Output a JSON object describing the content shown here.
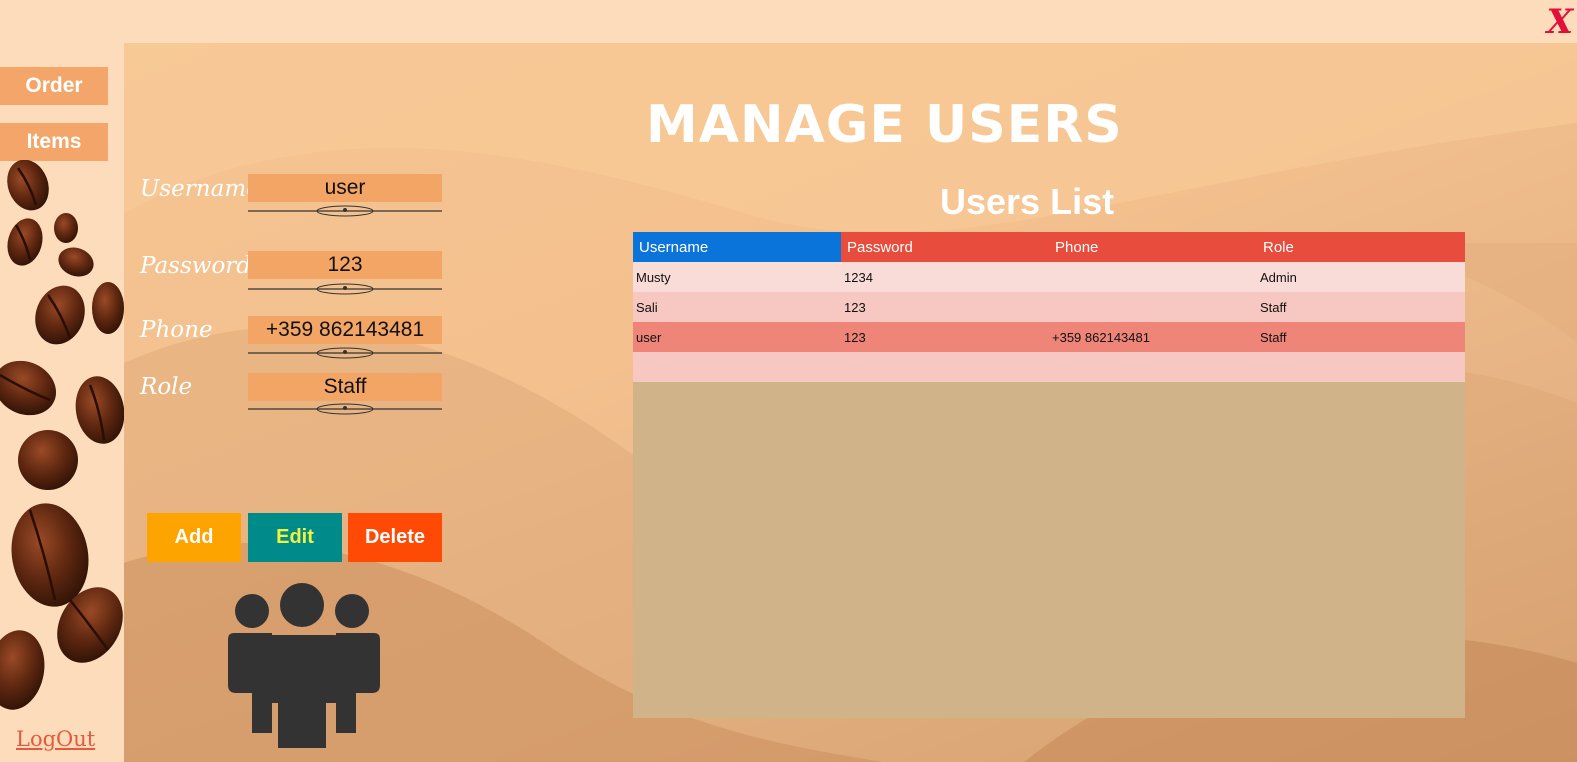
{
  "window": {
    "close_label": "X"
  },
  "sidebar": {
    "order_label": "Order",
    "items_label": "Items",
    "logout_label": "LogOut"
  },
  "header": {
    "title": "MANAGE USERS"
  },
  "form": {
    "username_label": "Username",
    "username_value": "user",
    "password_label": "Password",
    "password_value": "123",
    "phone_label": "Phone",
    "phone_value": "+359 862143481",
    "role_label": "Role",
    "role_value": "Staff"
  },
  "actions": {
    "add_label": "Add",
    "edit_label": "Edit",
    "delete_label": "Delete"
  },
  "users_list": {
    "title": "Users List",
    "columns": [
      "Username",
      "Password",
      "Phone",
      "Role"
    ],
    "rows": [
      {
        "username": "Musty",
        "password": "1234",
        "phone": "",
        "role": "Admin"
      },
      {
        "username": "Sali",
        "password": "123",
        "phone": "",
        "role": "Staff"
      },
      {
        "username": "user",
        "password": "123",
        "phone": "+359 862143481",
        "role": "Staff"
      }
    ]
  },
  "colors": {
    "header_selected": "#0a74da",
    "header_bg": "#e74c3c",
    "selected_row": "#ef8579",
    "add_button": "#fda400",
    "edit_button": "#008b8b",
    "delete_button": "#ff4a05",
    "close_icon": "#e0103a"
  },
  "icons": {
    "users_icon": "users-group-icon",
    "close_icon": "close-icon"
  }
}
